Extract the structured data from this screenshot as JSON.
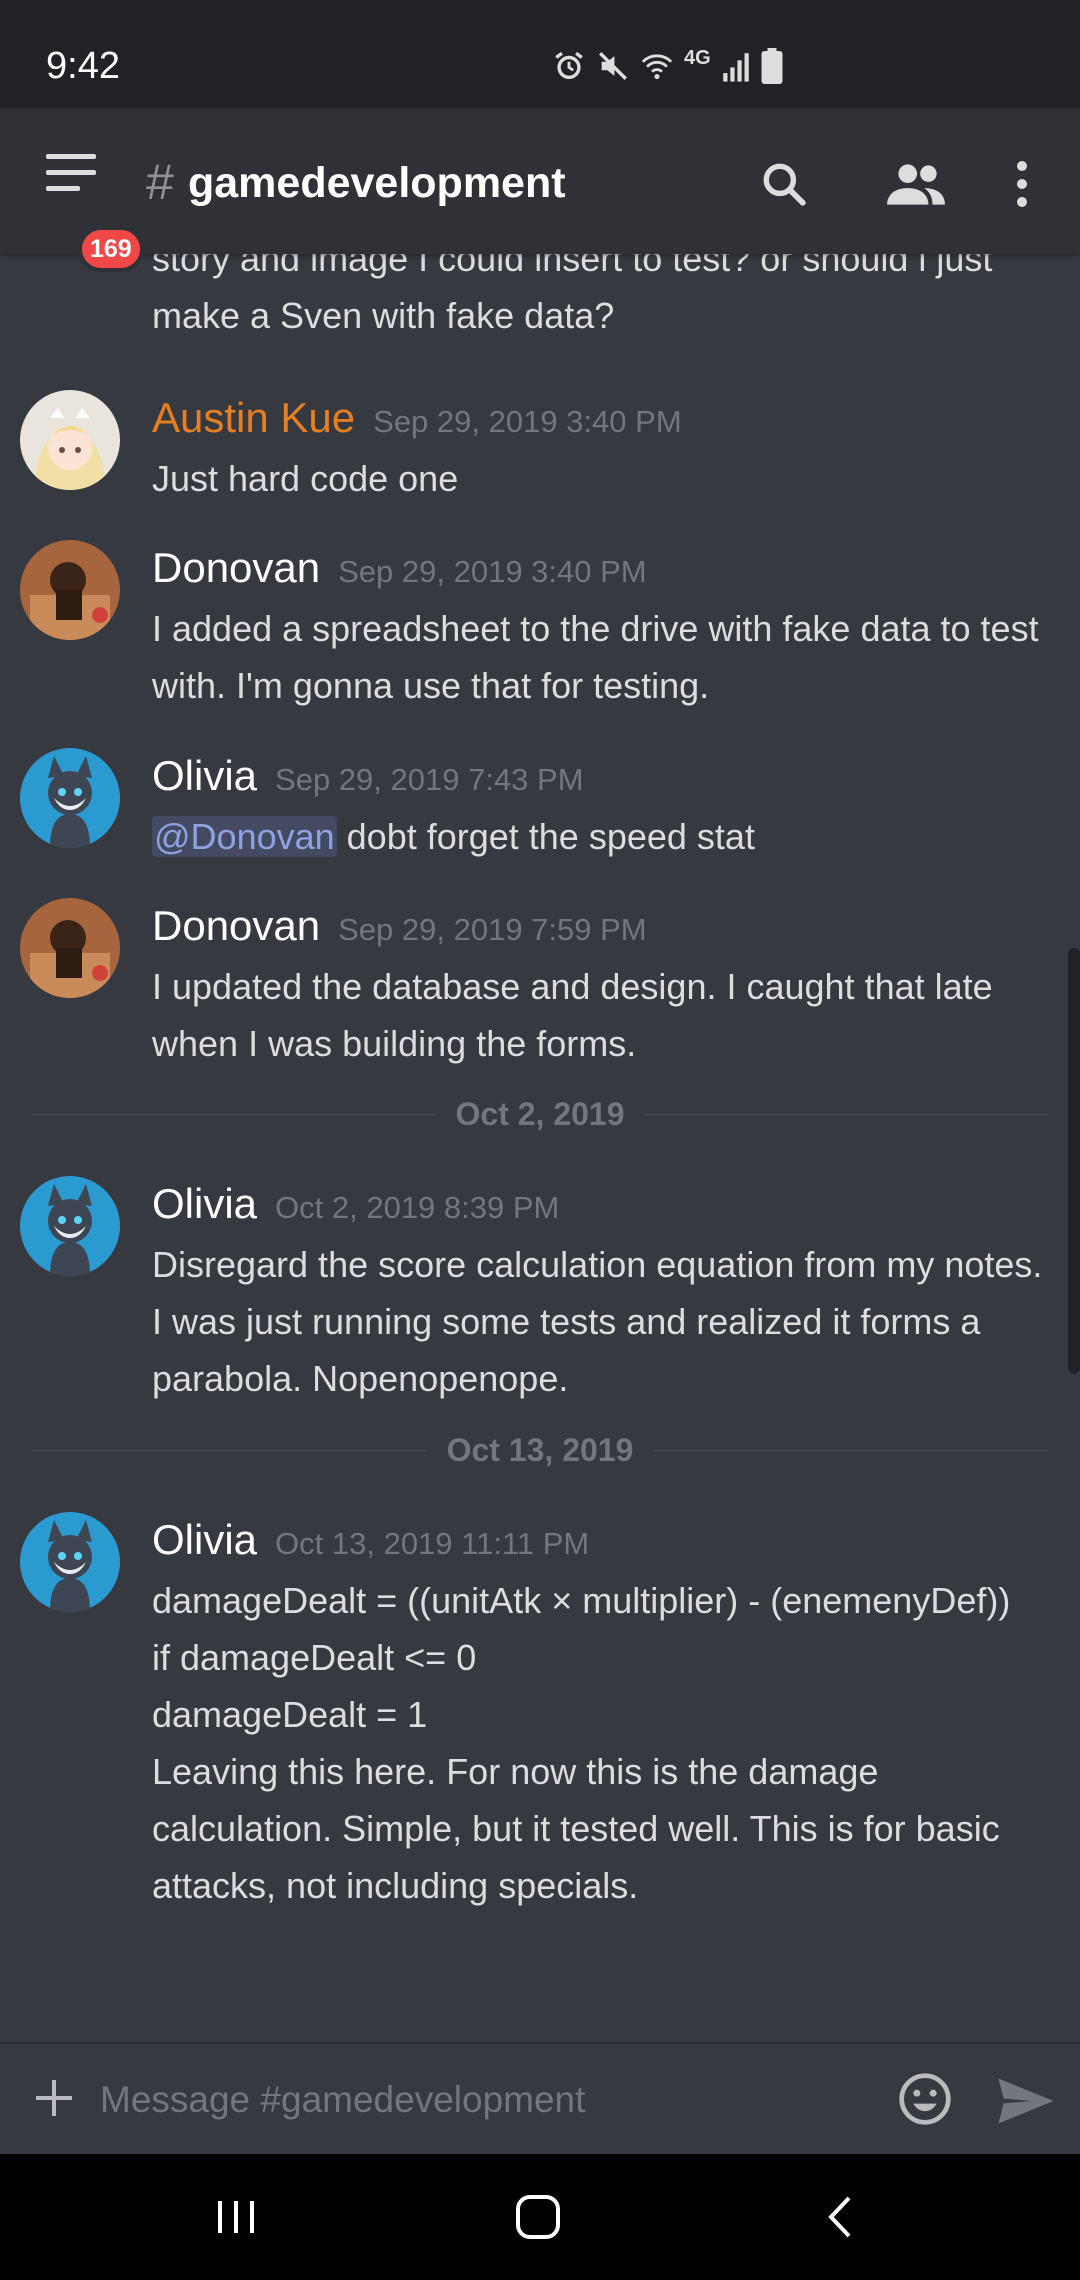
{
  "status_bar": {
    "time": "9:42",
    "network_label": "4G"
  },
  "header": {
    "notification_count": "169",
    "channel_prefix": "#",
    "channel_name": "gamedevelopment"
  },
  "messages": {
    "partial_text": "story and image I could insert to test? or should i just make a Sven with fake data?",
    "items": [
      {
        "author": "Austin Kue",
        "author_color": "#e67e22",
        "timestamp": "Sep 29, 2019 3:40 PM",
        "lines": [
          "Just hard code one"
        ]
      },
      {
        "author": "Donovan",
        "timestamp": "Sep 29, 2019 3:40 PM",
        "lines": [
          "I added a spreadsheet to the drive with fake data to test with. I'm gonna use that for testing."
        ]
      },
      {
        "author": "Olivia",
        "timestamp": "Sep 29, 2019 7:43 PM",
        "mention": "@Donovan",
        "text_after_mention": " dobt forget the speed stat"
      },
      {
        "author": "Donovan",
        "timestamp": "Sep 29, 2019 7:59 PM",
        "lines": [
          "I updated the database and design. I caught that late when I was building the forms."
        ]
      },
      {
        "author": "Olivia",
        "timestamp": "Oct 2, 2019 8:39 PM",
        "lines": [
          "Disregard the score calculation equation from my notes. I was just running some tests and realized it forms a parabola. Nopenopenope."
        ]
      },
      {
        "author": "Olivia",
        "timestamp": "Oct 13, 2019 11:11 PM",
        "lines": [
          "damageDealt = ((unitAtk × multiplier) - (enemenyDef))",
          "if damageDealt <= 0",
          "damageDealt = 1",
          "Leaving this here. For now this is the damage calculation. Simple, but it tested well. This is for basic attacks, not including specials."
        ]
      }
    ],
    "dividers": [
      "Oct 2, 2019",
      "Oct 13, 2019"
    ]
  },
  "composer": {
    "placeholder": "Message #gamedevelopment"
  },
  "icons": {
    "menu": "hamburger-icon",
    "search": "search-icon",
    "members": "members-icon",
    "more": "more-vertical-icon",
    "add": "plus-icon",
    "emoji": "emoji-icon",
    "send": "send-icon",
    "recents": "recent-apps-icon",
    "home": "home-icon",
    "back": "back-icon"
  },
  "colors": {
    "background": "#36393f",
    "header": "#2f3136",
    "accent": "#7289da",
    "badge": "#f04747",
    "mention_text": "#8ea1e1"
  }
}
